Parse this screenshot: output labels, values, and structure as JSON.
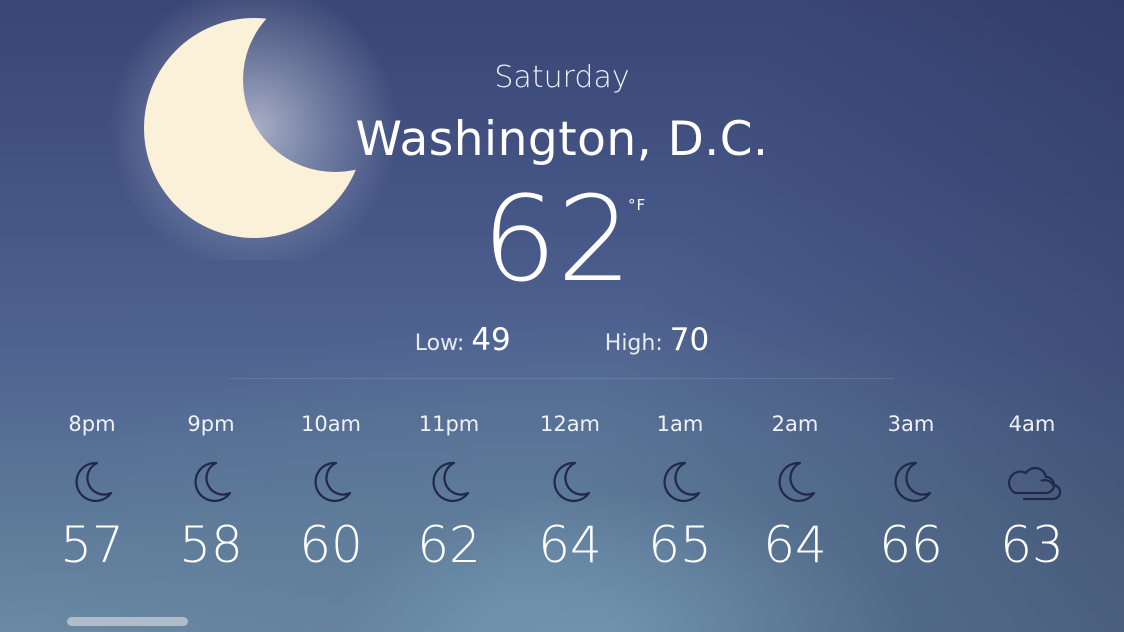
{
  "day": "Saturday",
  "city": "Washington, D.C.",
  "current": {
    "temp": "62",
    "unit": "°F",
    "condition_icon": "moon-icon"
  },
  "range": {
    "low_label": "Low:",
    "low": "49",
    "high_label": "High:",
    "high": "70"
  },
  "hourly": [
    {
      "time": "8pm",
      "temp": "57",
      "icon": "moon-icon"
    },
    {
      "time": "9pm",
      "temp": "58",
      "icon": "moon-icon"
    },
    {
      "time": "10am",
      "temp": "60",
      "icon": "moon-icon"
    },
    {
      "time": "11pm",
      "temp": "62",
      "icon": "moon-icon"
    },
    {
      "time": "12am",
      "temp": "64",
      "icon": "moon-icon"
    },
    {
      "time": "1am",
      "temp": "65",
      "icon": "moon-icon"
    },
    {
      "time": "2am",
      "temp": "64",
      "icon": "moon-icon"
    },
    {
      "time": "3am",
      "temp": "66",
      "icon": "moon-icon"
    },
    {
      "time": "4am",
      "temp": "63",
      "icon": "cloud-icon"
    }
  ],
  "colors": {
    "moon": "#fbf1d8",
    "icon_stroke": "#22284a"
  }
}
